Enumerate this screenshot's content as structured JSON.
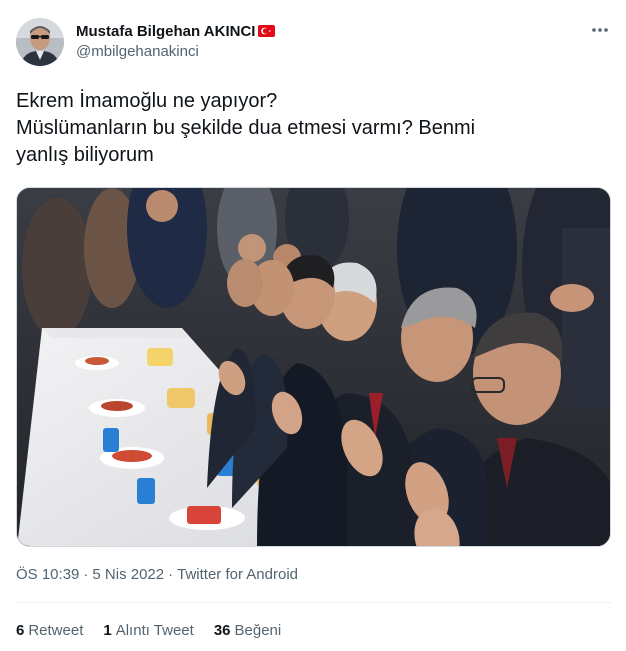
{
  "author": {
    "display_name": "Mustafa Bilgehan AKINCI",
    "handle": "@mbilgehanakinci",
    "flag_icon": "turkey-flag-icon"
  },
  "tweet": {
    "lines": [
      "Ekrem İmamoğlu ne yapıyor?",
      "Müslümanların bu şekilde dua etmesi varmı? Benmi",
      "yanlış biliyorum"
    ],
    "timestamp": "ÖS 10:39",
    "date": "5 Nis 2022",
    "source": "Twitter for Android",
    "separator": "·"
  },
  "stats": {
    "retweets": {
      "count": "6",
      "label": "Retweet"
    },
    "quotes": {
      "count": "1",
      "label": "Alıntı Tweet"
    },
    "likes": {
      "count": "36",
      "label": "Beğeni"
    }
  },
  "colors": {
    "text_primary": "#0f1419",
    "text_secondary": "#536471",
    "divider": "#eff3f4",
    "flag_red": "#e30a17"
  }
}
